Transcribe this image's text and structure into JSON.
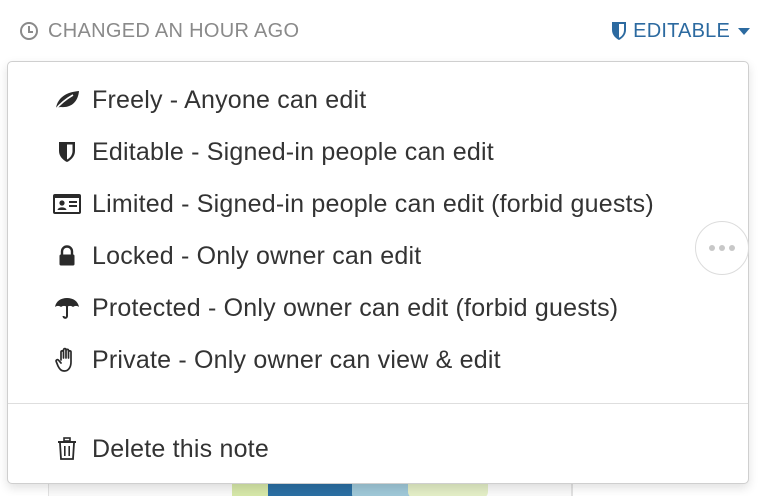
{
  "topbar": {
    "changed_label": "CHANGED AN HOUR AGO",
    "permission_label": "EDITABLE"
  },
  "menu": {
    "items": [
      {
        "icon": "leaf-icon",
        "label": "Freely - Anyone can edit"
      },
      {
        "icon": "shield-icon",
        "label": "Editable - Signed-in people can edit"
      },
      {
        "icon": "id-card-icon",
        "label": "Limited - Signed-in people can edit (forbid guests)"
      },
      {
        "icon": "lock-icon",
        "label": "Locked - Only owner can edit"
      },
      {
        "icon": "umbrella-icon",
        "label": "Protected - Only owner can edit (forbid guests)"
      },
      {
        "icon": "hand-icon",
        "label": "Private - Only owner can view & edit"
      }
    ],
    "delete_label": "Delete this note"
  },
  "colors": {
    "accent": "#2c6aa0",
    "muted_text": "#8a8a8a",
    "menu_text": "#333333"
  }
}
